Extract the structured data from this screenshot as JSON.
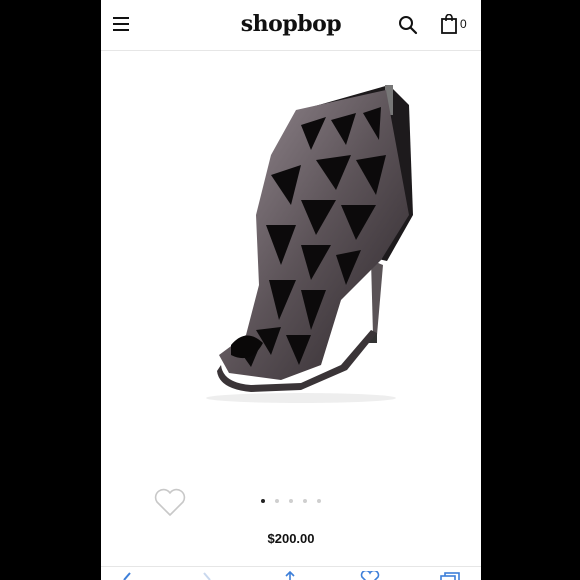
{
  "header": {
    "logo": "shopbop",
    "bag_count": "0",
    "icons": {
      "menu": "menu-icon",
      "search": "search-icon",
      "bag": "shopping-bag-icon"
    }
  },
  "product": {
    "image": "black metallic laser-cut open-toe stiletto bootie",
    "favorite_icon": "heart-icon",
    "gallery": {
      "total": 5,
      "active": 1
    },
    "price": "$200.00"
  },
  "bottom_bar": {
    "icons": [
      "back-arrow-icon",
      "forward-arrow-icon",
      "share-icon",
      "heart-icon",
      "tabs-icon"
    ],
    "accent": "#3d7fd9"
  }
}
